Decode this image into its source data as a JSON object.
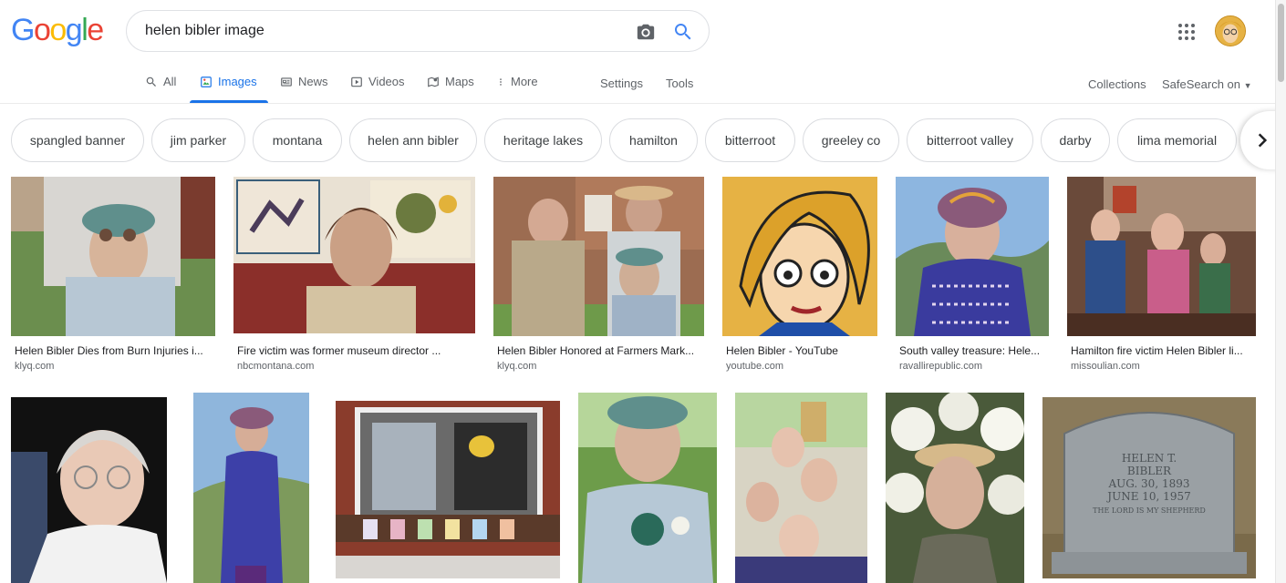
{
  "logo": {
    "letters": [
      "G",
      "o",
      "o",
      "g",
      "l",
      "e"
    ],
    "colors": [
      "#4285f4",
      "#ea4335",
      "#fbbc05",
      "#4285f4",
      "#34a853",
      "#ea4335"
    ]
  },
  "search": {
    "query": "helen bibler image"
  },
  "tabs": [
    {
      "label": "All",
      "icon": "search-icon"
    },
    {
      "label": "Images",
      "icon": "image-icon"
    },
    {
      "label": "News",
      "icon": "news-icon"
    },
    {
      "label": "Videos",
      "icon": "play-icon"
    },
    {
      "label": "Maps",
      "icon": "map-icon"
    },
    {
      "label": "More",
      "icon": "more-vert-icon"
    }
  ],
  "tools": {
    "settings": "Settings",
    "tools": "Tools"
  },
  "right_links": {
    "collections": "Collections",
    "safesearch": "SafeSearch on"
  },
  "chips": [
    "spangled banner",
    "jim parker",
    "montana",
    "helen ann bibler",
    "heritage lakes",
    "hamilton",
    "bitterroot",
    "greeley co",
    "bitterroot valley",
    "darby",
    "lima memorial"
  ],
  "results_row1": [
    {
      "caption": "Helen Bibler Dies from Burn Injuries i...",
      "source": "klyq.com"
    },
    {
      "caption": "Fire victim was former museum director ...",
      "source": "nbcmontana.com"
    },
    {
      "caption": "Helen Bibler Honored at Farmers Mark...",
      "source": "klyq.com"
    },
    {
      "caption": "Helen Bibler - YouTube",
      "source": "youtube.com"
    },
    {
      "caption": "South valley treasure: Hele...",
      "source": "ravallirepublic.com"
    },
    {
      "caption": "Hamilton fire victim Helen Bibler li...",
      "source": "missoulian.com"
    }
  ],
  "gravestone": {
    "name": "HELEN T.",
    "surname": "BIBLER",
    "born": "AUG. 30, 1893",
    "died": "JUNE 10, 1957",
    "epitaph": "THE LORD IS MY SHEPHERD"
  }
}
